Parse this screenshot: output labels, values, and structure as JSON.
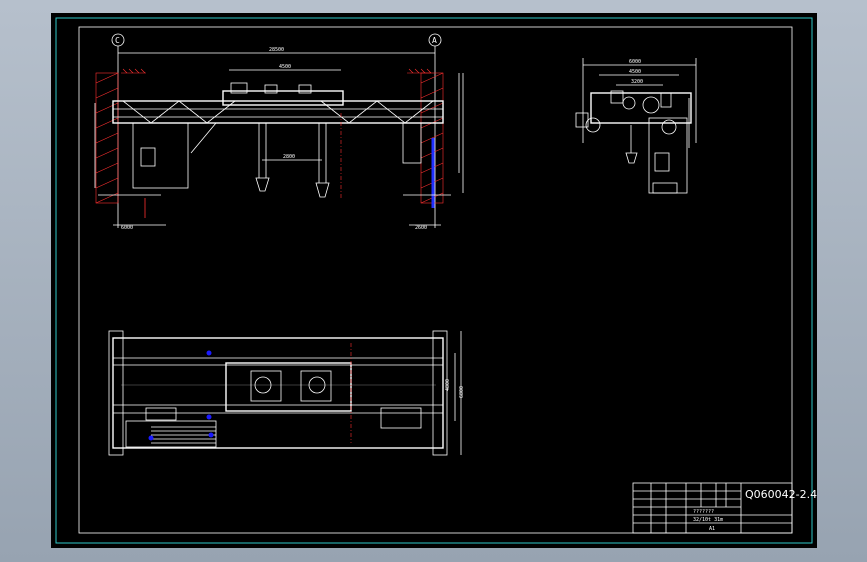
{
  "title_block": {
    "drawing_code": "Q060042-2.4H",
    "text_row_1": "???????",
    "text_row_2": "32/10t 31m",
    "sheet_size": "A1"
  },
  "dimensions": {
    "span": "28500",
    "top_trolley": "4500",
    "hook_spacing": "2800",
    "side_left": "6000",
    "side_right": "2600",
    "side_view_width": "6000",
    "side_view_inner": "4500",
    "side_view_core": "3200",
    "plan_height": "6800",
    "plan_inner": "4800"
  },
  "axis_labels": {
    "left": "C",
    "right": "A"
  },
  "colors": {
    "background": "#000000",
    "line": "#ffffff",
    "hatch": "#ff3030",
    "frame": "#2ec8c8",
    "marker": "#1a1aff"
  }
}
